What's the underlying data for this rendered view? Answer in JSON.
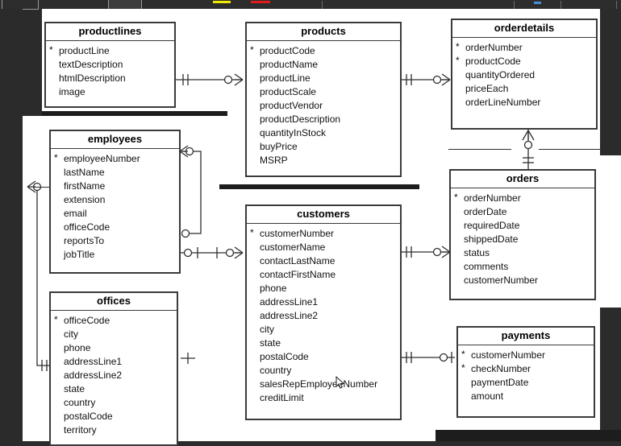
{
  "toolbar": {
    "swatch_yellow": "#f2e900",
    "swatch_red": "#e01b1b",
    "accent_blue": "#4a90d9"
  },
  "diagram": {
    "notation": "crow's foot",
    "pk_marker": "*",
    "entities": [
      {
        "name": "productlines",
        "fields": [
          {
            "label": "productLine",
            "pk": true
          },
          {
            "label": "textDescription",
            "pk": false
          },
          {
            "label": "htmlDescription",
            "pk": false
          },
          {
            "label": "image",
            "pk": false
          }
        ]
      },
      {
        "name": "products",
        "fields": [
          {
            "label": "productCode",
            "pk": true
          },
          {
            "label": "productName",
            "pk": false
          },
          {
            "label": "productLine",
            "pk": false
          },
          {
            "label": "productScale",
            "pk": false
          },
          {
            "label": "productVendor",
            "pk": false
          },
          {
            "label": "productDescription",
            "pk": false
          },
          {
            "label": "quantityInStock",
            "pk": false
          },
          {
            "label": "buyPrice",
            "pk": false
          },
          {
            "label": "MSRP",
            "pk": false
          }
        ]
      },
      {
        "name": "orderdetails",
        "fields": [
          {
            "label": "orderNumber",
            "pk": true
          },
          {
            "label": "productCode",
            "pk": true
          },
          {
            "label": "quantityOrdered",
            "pk": false
          },
          {
            "label": "priceEach",
            "pk": false
          },
          {
            "label": "orderLineNumber",
            "pk": false
          }
        ]
      },
      {
        "name": "employees",
        "fields": [
          {
            "label": "employeeNumber",
            "pk": true
          },
          {
            "label": "lastName",
            "pk": false
          },
          {
            "label": "firstName",
            "pk": false
          },
          {
            "label": "extension",
            "pk": false
          },
          {
            "label": "email",
            "pk": false
          },
          {
            "label": "officeCode",
            "pk": false
          },
          {
            "label": "reportsTo",
            "pk": false
          },
          {
            "label": "jobTitle",
            "pk": false
          }
        ]
      },
      {
        "name": "offices",
        "fields": [
          {
            "label": "officeCode",
            "pk": true
          },
          {
            "label": "city",
            "pk": false
          },
          {
            "label": "phone",
            "pk": false
          },
          {
            "label": "addressLine1",
            "pk": false
          },
          {
            "label": "addressLine2",
            "pk": false
          },
          {
            "label": "state",
            "pk": false
          },
          {
            "label": "country",
            "pk": false
          },
          {
            "label": "postalCode",
            "pk": false
          },
          {
            "label": "territory",
            "pk": false
          }
        ]
      },
      {
        "name": "customers",
        "fields": [
          {
            "label": "customerNumber",
            "pk": true
          },
          {
            "label": "customerName",
            "pk": false
          },
          {
            "label": "contactLastName",
            "pk": false
          },
          {
            "label": "contactFirstName",
            "pk": false
          },
          {
            "label": "phone",
            "pk": false
          },
          {
            "label": "addressLine1",
            "pk": false
          },
          {
            "label": "addressLine2",
            "pk": false
          },
          {
            "label": "city",
            "pk": false
          },
          {
            "label": "state",
            "pk": false
          },
          {
            "label": "postalCode",
            "pk": false
          },
          {
            "label": "country",
            "pk": false
          },
          {
            "label": "salesRepEmployeeNumber",
            "pk": false
          },
          {
            "label": "creditLimit",
            "pk": false
          }
        ]
      },
      {
        "name": "orders",
        "fields": [
          {
            "label": "orderNumber",
            "pk": true
          },
          {
            "label": "orderDate",
            "pk": false
          },
          {
            "label": "requiredDate",
            "pk": false
          },
          {
            "label": "shippedDate",
            "pk": false
          },
          {
            "label": "status",
            "pk": false
          },
          {
            "label": "comments",
            "pk": false
          },
          {
            "label": "customerNumber",
            "pk": false
          }
        ]
      },
      {
        "name": "payments",
        "fields": [
          {
            "label": "customerNumber",
            "pk": true
          },
          {
            "label": "checkNumber",
            "pk": true
          },
          {
            "label": "paymentDate",
            "pk": false
          },
          {
            "label": "amount",
            "pk": false
          }
        ]
      }
    ],
    "relationships": [
      {
        "from": "productlines",
        "to": "products",
        "from_card": "one",
        "to_card": "zero-or-many"
      },
      {
        "from": "products",
        "to": "orderdetails",
        "from_card": "one",
        "to_card": "zero-or-many"
      },
      {
        "from": "orderdetails",
        "to": "orders",
        "from_card": "zero-or-many",
        "to_card": "one"
      },
      {
        "from": "customers",
        "to": "orders",
        "from_card": "one",
        "to_card": "zero-or-many"
      },
      {
        "from": "customers",
        "to": "payments",
        "from_card": "one",
        "to_card": "zero-or-one"
      },
      {
        "from": "employees",
        "to": "customers",
        "from_card": "one",
        "to_card": "zero-or-many"
      },
      {
        "from": "employees",
        "to": "employees",
        "from_card": "zero-or-one",
        "to_card": "zero-or-many"
      },
      {
        "from": "offices",
        "to": "employees",
        "from_card": "one",
        "to_card": "zero-or-many"
      }
    ]
  }
}
